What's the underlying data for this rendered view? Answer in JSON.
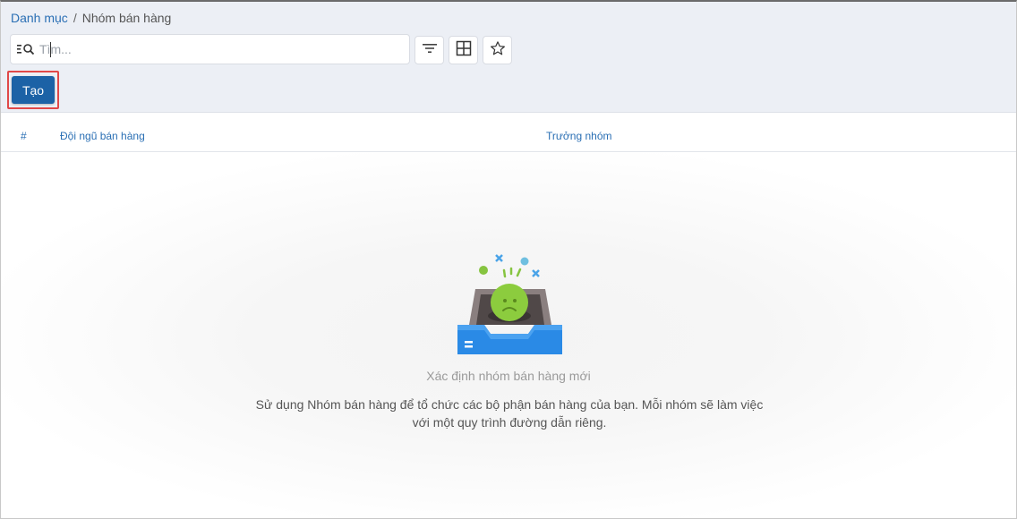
{
  "breadcrumb": {
    "parent": "Danh mục",
    "separator": "/",
    "current": "Nhóm bán hàng"
  },
  "search": {
    "placeholder": "Tìm...",
    "value": ""
  },
  "toolbar": {
    "filter_icon": "filter-icon",
    "layout_icon": "grid-layout-icon",
    "favorite_icon": "star-icon",
    "create_label": "Tạo"
  },
  "table": {
    "columns": [
      "#",
      "Đội ngũ bán hàng",
      "Trưởng nhóm"
    ]
  },
  "empty_state": {
    "icon": "empty-inbox-sad-face-icon",
    "title": "Xác định nhóm bán hàng mới",
    "description": "Sử dụng Nhóm bán hàng để tổ chức các bộ phận bán hàng của bạn. Mỗi nhóm sẽ làm việc với một quy trình đường dẫn riêng."
  },
  "colors": {
    "accent": "#1c62a6",
    "link": "#2a6fb4",
    "highlight": "#e04848",
    "panel_bg": "#eceff5"
  }
}
